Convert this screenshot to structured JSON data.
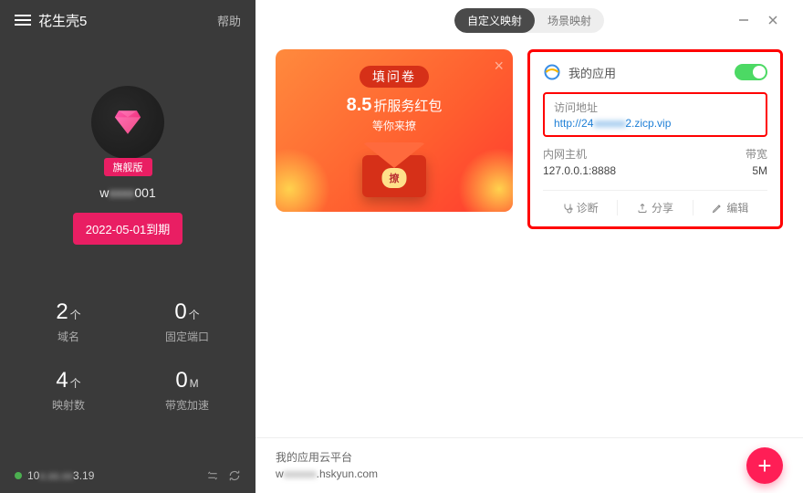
{
  "sidebar": {
    "title": "花生壳5",
    "help": "帮助",
    "edition": "旗舰版",
    "username_prefix": "w",
    "username_blur": "xxxx",
    "username_suffix": "001",
    "expiry": "2022-05-01到期",
    "stats": [
      {
        "num": "2",
        "unit": "个",
        "label": "域名"
      },
      {
        "num": "0",
        "unit": "个",
        "label": "固定端口"
      },
      {
        "num": "4",
        "unit": "个",
        "label": "映射数"
      },
      {
        "num": "0",
        "unit": "M",
        "label": "带宽加速"
      }
    ],
    "footer": {
      "ip_prefix": "10",
      "ip_blur": "x.xx.xx",
      "ip_suffix": "3.19"
    }
  },
  "topbar": {
    "tab_custom": "自定义映射",
    "tab_scene": "场景映射"
  },
  "promo": {
    "badge": "填问卷",
    "line1_bold": "8.5",
    "line1_rest": "折服务红包",
    "line2": "等你来撩",
    "env_btn": "撩"
  },
  "card": {
    "title": "我的应用",
    "addr_label": "访问地址",
    "addr_prefix": "http://24",
    "addr_blur": "xxxxxxx",
    "addr_suffix": "2.zicp.vip",
    "host_label": "内网主机",
    "host_value": "127.0.0.1:8888",
    "bw_label": "带宽",
    "bw_value": "5M",
    "act_diag": "诊断",
    "act_share": "分享",
    "act_edit": "编辑"
  },
  "bottom": {
    "platform": "我的应用云平台",
    "domain_prefix": "w",
    "domain_blur": "xxxxxx",
    "domain_suffix": ".hskyun.com"
  }
}
